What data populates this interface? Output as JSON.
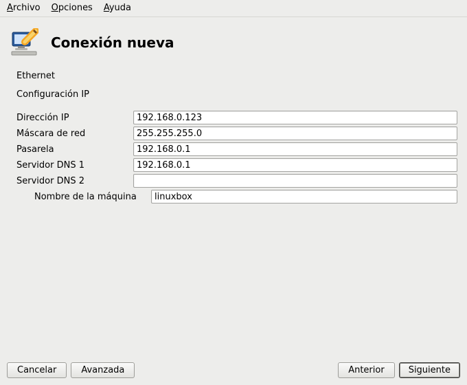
{
  "menubar": {
    "file": "Archivo",
    "options": "Opciones",
    "help": "Ayuda"
  },
  "header": {
    "title": "Conexión nueva"
  },
  "sections": {
    "ethernet": "Ethernet",
    "ipconfig": "Configuración IP"
  },
  "labels": {
    "ip": "Dirección IP",
    "netmask": "Máscara de red",
    "gateway": "Pasarela",
    "dns1": "Servidor DNS 1",
    "dns2": "Servidor DNS 2",
    "hostname": "Nombre de la máquina"
  },
  "values": {
    "ip": "192.168.0.123",
    "netmask": "255.255.255.0",
    "gateway": "192.168.0.1",
    "dns1": "192.168.0.1",
    "dns2": "",
    "hostname": "linuxbox"
  },
  "buttons": {
    "cancel": "Cancelar",
    "advanced": "Avanzada",
    "back": "Anterior",
    "next": "Siguiente"
  }
}
